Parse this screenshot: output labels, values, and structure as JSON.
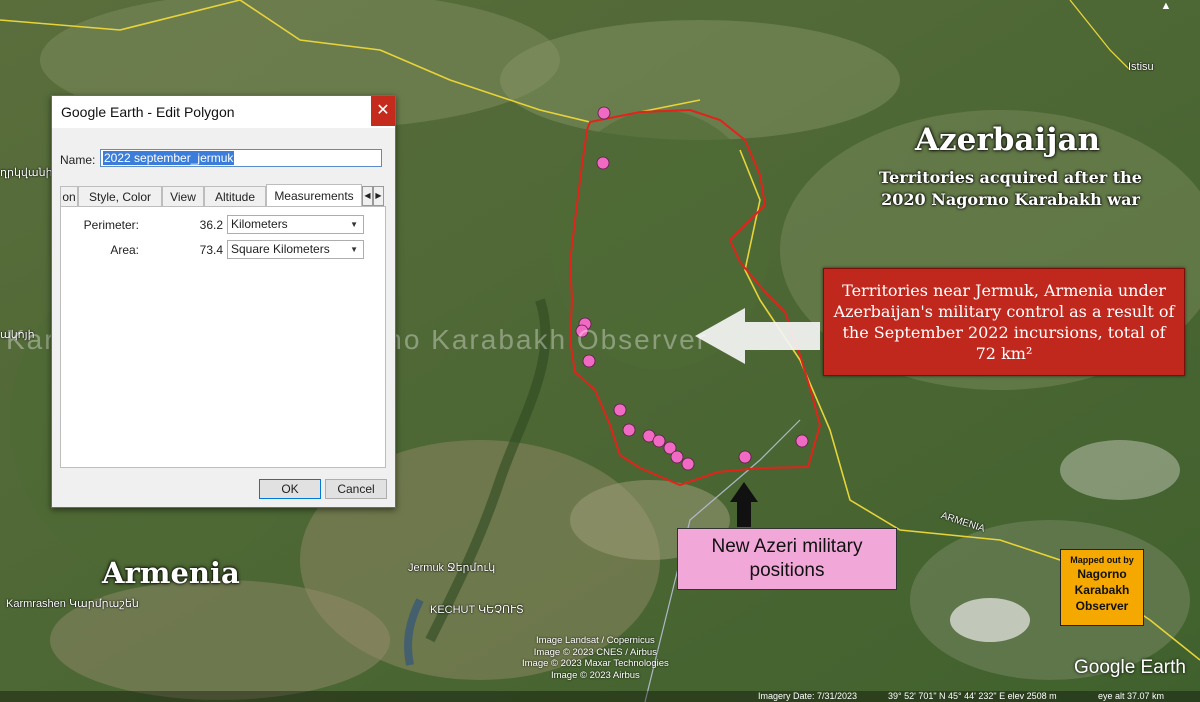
{
  "map": {
    "title_azerbaijan": "Azerbaijan",
    "subtitle_azerbaijan": "Territories acquired after the 2020 Nagorno Karabakh war",
    "title_armenia": "Armenia",
    "places": {
      "istisu": "Istisu",
      "jermuk": "Jermuk Ջերմուկ",
      "karmrashen": "Karmrashen Կարմրաշեն",
      "kechut": "KECHUT ԿԵՉՈՒՏ",
      "armenia_road": "ARMENIA",
      "left_edge_1": "ղրկվանի",
      "left_edge_2": "ակոյի"
    },
    "watermark_1": "Karabakh Observer",
    "watermark_2": "Nagorno Karabakh Observer",
    "watermark_3": "Karabakh Observer",
    "red_box_text": "Territories near Jermuk, Armenia under Azerbaijan's military control as a result of the September 2022 incursions, total of 72 km²",
    "pink_box_text": "New Azeri military positions",
    "orange_box": {
      "line1": "Mapped out by",
      "line2": "Nagorno",
      "line3": "Karabakh",
      "line4": "Observer"
    },
    "credits": [
      "Image Landsat / Copernicus",
      "Image © 2023 CNES / Airbus",
      "Image © 2023 Maxar Technologies",
      "Image © 2023 Airbus"
    ],
    "logo": "Google Earth",
    "status": {
      "imagery_date": "Imagery Date: 7/31/2023",
      "coords": "39° 52' 701\" N   45° 44' 232\" E   elev 2508 m",
      "eye_alt": "eye alt  37.07 km"
    },
    "colors": {
      "polygon": "#e0241b",
      "border": "#e8d43a",
      "pin": "#f06ac4"
    }
  },
  "dialog": {
    "title": "Google Earth - Edit Polygon",
    "close_icon": "close-icon",
    "name_label": "Name:",
    "name_value": "2022 september_jermuk",
    "tabs": [
      "on",
      "Style, Color",
      "View",
      "Altitude",
      "Measurements"
    ],
    "active_tab": "Measurements",
    "perimeter_label": "Perimeter:",
    "perimeter_value": "36.2",
    "perimeter_unit": "Kilometers",
    "area_label": "Area:",
    "area_value": "73.4",
    "area_unit": "Square Kilometers",
    "ok_label": "OK",
    "cancel_label": "Cancel"
  }
}
